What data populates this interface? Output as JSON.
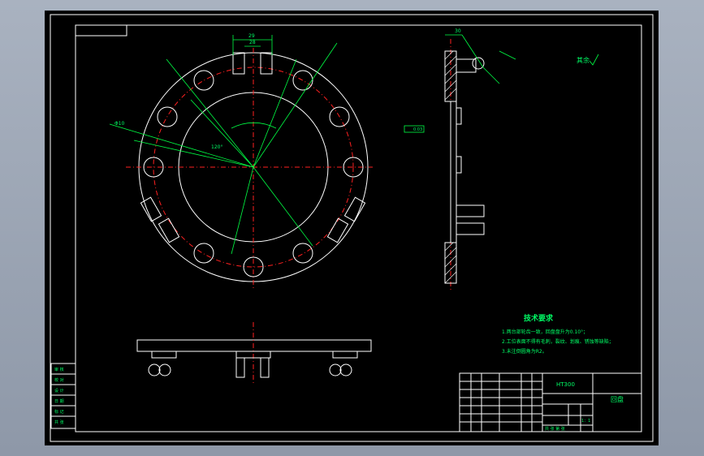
{
  "technical_requirements": {
    "title": "技术要求",
    "items": [
      "1.两台部轮齿一致，回盘盘升为0.10°；",
      "2.工位表面不得有毛刺，裂纹、划痕、锈蚀等缺陷；",
      "3.未注倒圆角为R2。"
    ]
  },
  "title_block": {
    "part_name": "回盘",
    "code": "HT300",
    "scale": "1：1",
    "sheet": "共  张  第  张"
  },
  "roughness_note": "其余",
  "dims": {
    "top_width": "29",
    "top_inner": "28",
    "side_top": "30",
    "bolt_circle": "Φ10",
    "angle": "120°",
    "datum": "0.03"
  },
  "left_table": [
    "审  核",
    "校  对",
    "设  计",
    "日  期",
    "标  记",
    "共  张"
  ],
  "colors": {
    "background": "#000000",
    "outline": "#ffffff",
    "centerline": "#ff2020",
    "dimension": "#00ff44",
    "text": "#00ff66"
  }
}
